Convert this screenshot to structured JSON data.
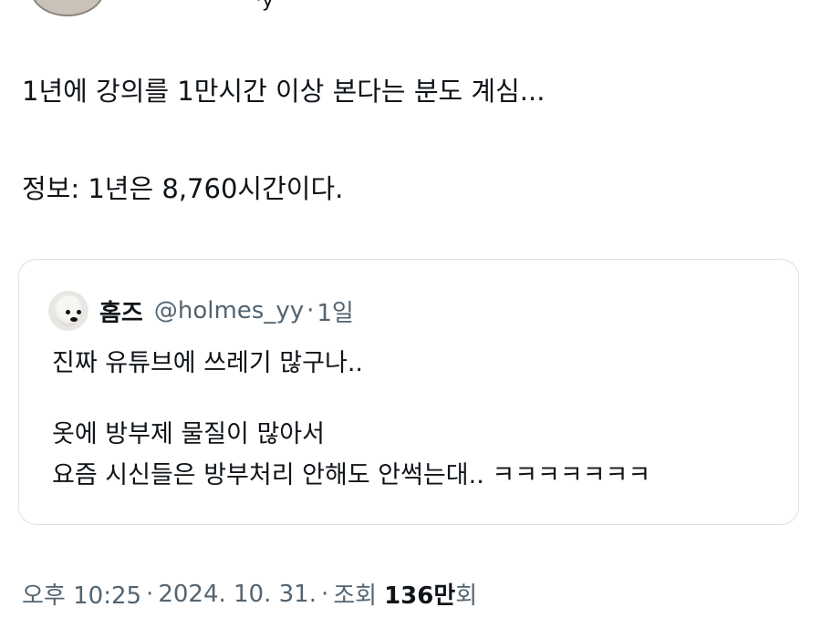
{
  "tweet": {
    "author_fragment": "·y",
    "lines": [
      "1년에 강의를 1만시간 이상 본다는 분도 계심...",
      "정보: 1년은 8,760시간이다."
    ]
  },
  "quote": {
    "author": "홈즈",
    "handle": "@holmes_yy",
    "separator": "·",
    "time": "1일",
    "lines": [
      "진짜 유튜브에 쓰레기 많구나..",
      "옷에 방부제 물질이 많아서",
      "요즘 시신들은 방부처리 안해도 안썩는대.. ㅋㅋㅋㅋㅋㅋㅋ"
    ]
  },
  "meta": {
    "time": "오후 10:25",
    "separator": "·",
    "date": "2024. 10. 31.",
    "views_label": "조회",
    "views_count": "136만",
    "views_suffix": "회"
  }
}
